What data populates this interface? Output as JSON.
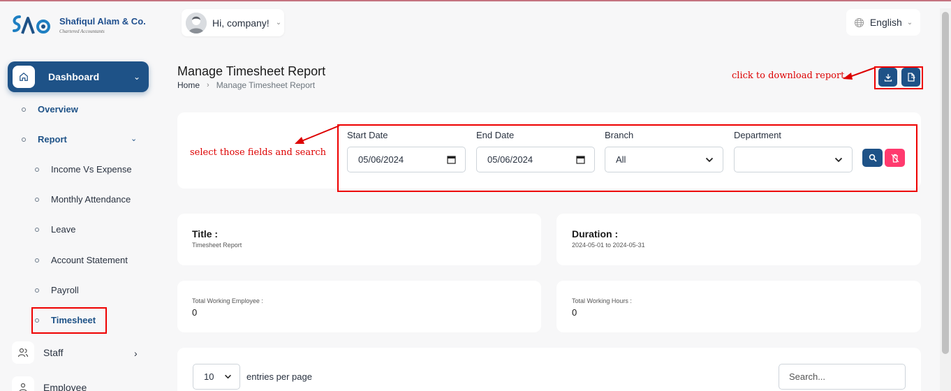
{
  "brand": {
    "name": "Shafiqul Alam & Co.",
    "tagline": "Chartered Accountants"
  },
  "header": {
    "greeting": "Hi, company!",
    "language": "English"
  },
  "sidebar": {
    "dashboard": "Dashboard",
    "overview": "Overview",
    "report": "Report",
    "report_items": [
      "Income Vs Expense",
      "Monthly Attendance",
      "Leave",
      "Account Statement",
      "Payroll",
      "Timesheet"
    ],
    "staff": "Staff",
    "employee": "Employee"
  },
  "page": {
    "title": "Manage Timesheet Report",
    "breadcrumb": {
      "home": "Home",
      "current": "Manage Timesheet Report"
    }
  },
  "annotations": {
    "download": "click to download report",
    "fields": "select those fields and search"
  },
  "filters": {
    "start_date": {
      "label": "Start Date",
      "value": "05/06/2024"
    },
    "end_date": {
      "label": "End Date",
      "value": "05/06/2024"
    },
    "branch": {
      "label": "Branch",
      "value": "All"
    },
    "department": {
      "label": "Department",
      "value": ""
    }
  },
  "summary": {
    "title_label": "Title :",
    "title_value": "Timesheet Report",
    "duration_label": "Duration :",
    "duration_value": "2024-05-01 to 2024-05-31",
    "employees_label": "Total Working Employee :",
    "employees_value": "0",
    "hours_label": "Total Working Hours :",
    "hours_value": "0"
  },
  "table": {
    "per_page": "10",
    "per_page_label": "entries per page",
    "search_placeholder": "Search..."
  },
  "colors": {
    "primary": "#1e5287",
    "danger": "#ff3a6e",
    "annotation": "#dd0000"
  }
}
